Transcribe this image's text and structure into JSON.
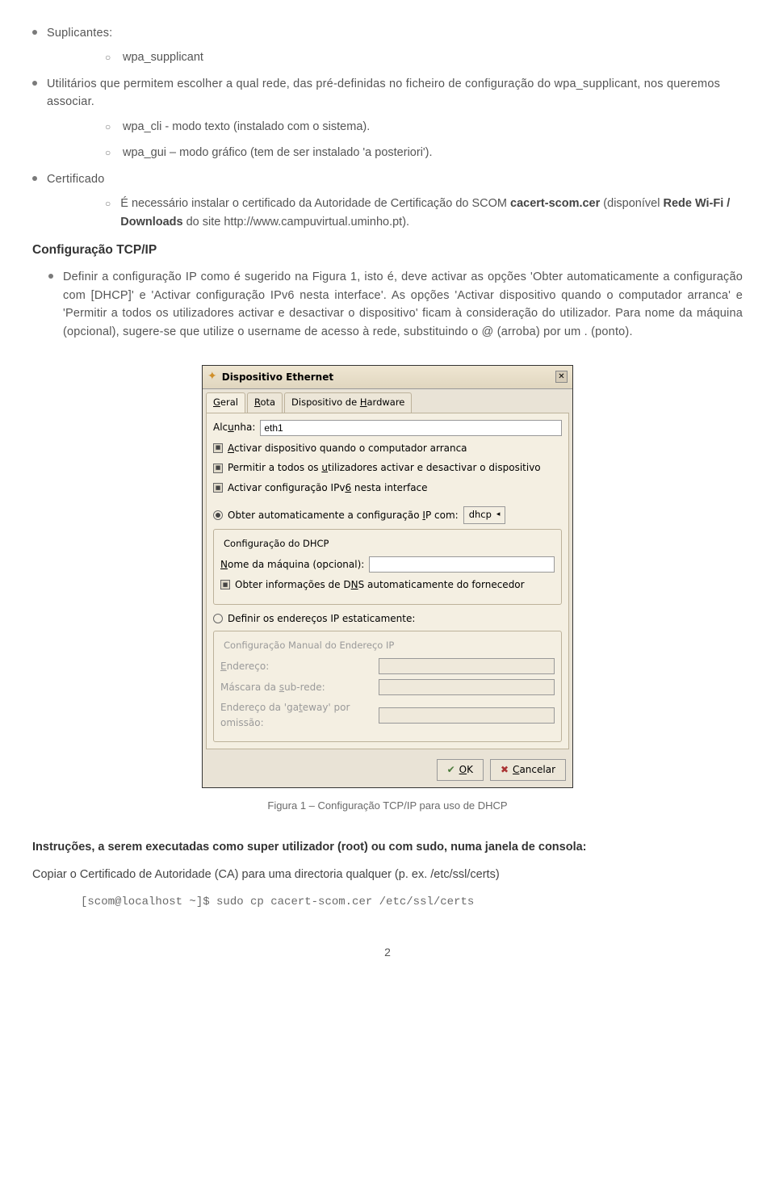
{
  "doc": {
    "suplicantes_label": "Suplicantes:",
    "wpa_supplicant": "wpa_supplicant",
    "utilitarios_intro": "Utilitários que permitem escolher a qual rede, das pré-definidas no ficheiro de configuração do wpa_supplicant, nos queremos associar.",
    "wpa_cli": "wpa_cli - modo texto (instalado com o sistema).",
    "wpa_gui": "wpa_gui – modo gráfico (tem de ser instalado 'a posteriori').",
    "certificado_label": "Certificado",
    "cert_text_a": "É necessário instalar o certificado da Autoridade de Certificação do SCOM ",
    "cert_bold_a": "cacert-scom.cer",
    "cert_text_b": " (disponível ",
    "cert_bold_b": "Rede Wi-Fi / Downloads",
    "cert_text_c": " do site http://www.campuvirtual.uminho.pt).",
    "tcp_heading": "Configuração TCP/IP",
    "tcp_para": "Definir a configuração IP como é sugerido na Figura 1, isto é, deve activar as opções 'Obter automaticamente a configuração com [DHCP]' e 'Activar configuração IPv6 nesta interface'. As opções 'Activar dispositivo quando o computador arranca' e 'Permitir a todos os utilizadores activar e desactivar o dispositivo' ficam à consideração do utilizador. Para nome da máquina (opcional), sugere-se que utilize o username de acesso à rede, substituindo o @ (arroba) por um . (ponto).",
    "caption": "Figura 1 – Configuração TCP/IP para uso de DHCP",
    "footer_head": "Instruções, a serem executadas como super utilizador (root) ou com sudo, numa janela de consola:",
    "footer_text": "Copiar o Certificado de Autoridade (CA) para uma directoria qualquer (p. ex. /etc/ssl/certs)",
    "code": "[scom@localhost ~]$ sudo cp cacert-scom.cer /etc/ssl/certs",
    "pagenum": "2"
  },
  "dialog": {
    "title": "Dispositivo Ethernet",
    "tabs": {
      "geral": "Geral",
      "rota": "Rota",
      "hardware": "Dispositivo de Hardware"
    },
    "alcunha_label": "Alcunha:",
    "alcunha_value": "eth1",
    "chk_activar": "Activar dispositivo quando o computador arranca",
    "chk_permitir": "Permitir a todos os utilizadores activar e desactivar o dispositivo",
    "chk_ipv6": "Activar configuração IPv6 nesta interface",
    "radio_auto": "Obter automaticamente a configuração IP com:",
    "dd_value": "dhcp",
    "group1_title": "Configuração do DHCP",
    "nome_maquina": "Nome da máquina (opcional):",
    "chk_dns": "Obter informações de DNS automaticamente do fornecedor",
    "radio_static": "Definir os endereços IP estaticamente:",
    "group2_title": "Configuração Manual do Endereço IP",
    "endereco": "Endereço:",
    "mascara": "Máscara da sub-rede:",
    "gateway": "Endereço da 'gateway' por omissão:",
    "ok": "OK",
    "cancel": "Cancelar"
  }
}
